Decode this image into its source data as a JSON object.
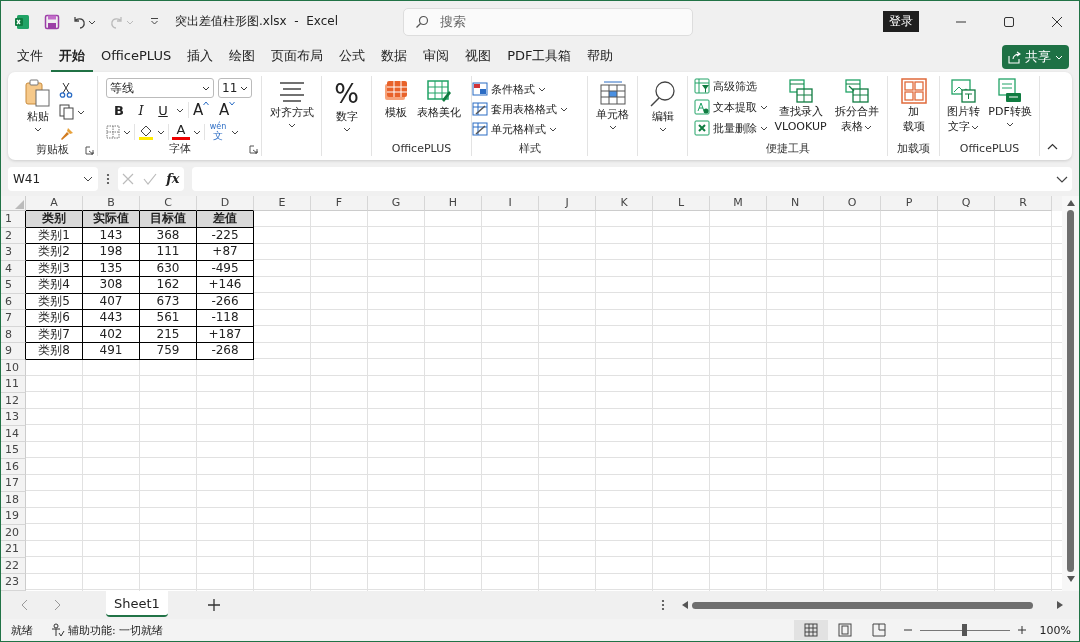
{
  "window": {
    "title": "突出差值柱形图.xlsx  -  Excel",
    "search_placeholder": "搜索",
    "sign_in": "登录"
  },
  "quick_access": {
    "redo_disabled": true
  },
  "menu_tabs": [
    {
      "label": "文件",
      "selected": false
    },
    {
      "label": "开始",
      "selected": true
    },
    {
      "label": "OfficePLUS",
      "selected": false
    },
    {
      "label": "插入",
      "selected": false
    },
    {
      "label": "绘图",
      "selected": false
    },
    {
      "label": "页面布局",
      "selected": false
    },
    {
      "label": "公式",
      "selected": false
    },
    {
      "label": "数据",
      "selected": false
    },
    {
      "label": "审阅",
      "selected": false
    },
    {
      "label": "视图",
      "selected": false
    },
    {
      "label": "PDF工具箱",
      "selected": false
    },
    {
      "label": "帮助",
      "selected": false
    }
  ],
  "share_button": "共享",
  "ribbon": {
    "clipboard": {
      "label": "剪贴板",
      "paste": "粘贴"
    },
    "font": {
      "label": "字体",
      "font_name": "等线",
      "font_size": "11",
      "bold": "B",
      "italic": "I",
      "underline": "U",
      "grow": "A",
      "shrink": "A",
      "font_color": "A",
      "phonetic": "wén",
      "phonetic_char": "文"
    },
    "alignment": {
      "label": "对齐方式"
    },
    "number": {
      "label": "数字",
      "symbol": "%"
    },
    "officeplus": {
      "label": "OfficePLUS",
      "buttons": [
        "模板",
        "表格美化"
      ]
    },
    "styles": {
      "label": "样式",
      "buttons": [
        "条件格式",
        "套用表格格式",
        "单元格样式"
      ]
    },
    "cells": {
      "label": "单元格"
    },
    "editing": {
      "label": "编辑"
    },
    "quick_tools": {
      "label": "便捷工具",
      "small_buttons": [
        {
          "label": "高级筛选",
          "dropdown": false
        },
        {
          "label": "文本提取",
          "dropdown": true
        },
        {
          "label": "批量删除",
          "dropdown": true
        }
      ],
      "large_buttons": [
        {
          "lines": [
            "查找录入",
            "VLOOKUP"
          ],
          "dropdown": false
        },
        {
          "lines": [
            "拆分合并",
            "表格"
          ],
          "dropdown": true
        }
      ]
    },
    "addins": {
      "label": "加载项",
      "lines": [
        "加",
        "载项"
      ]
    },
    "officeplus2": {
      "label": "OfficePLUS",
      "buttons": [
        {
          "lines": [
            "图片转",
            "文字"
          ],
          "dropdown": true
        },
        {
          "lines": [
            "PDF转换"
          ],
          "dropdown": true
        }
      ]
    }
  },
  "formula_bar": {
    "name_box": "W41",
    "function_label": "fx"
  },
  "sheet": {
    "columns": [
      "A",
      "B",
      "C",
      "D",
      "E",
      "F",
      "G",
      "H",
      "I",
      "J",
      "K",
      "L",
      "M",
      "N",
      "O",
      "P",
      "Q",
      "R"
    ],
    "row_numbers": [
      "1",
      "2",
      "3",
      "4",
      "5",
      "6",
      "7",
      "8",
      "9",
      "10",
      "11",
      "12",
      "13",
      "14",
      "15",
      "16",
      "17",
      "18",
      "19",
      "20",
      "21",
      "22",
      "23"
    ],
    "cells": [
      [
        "类别",
        "实际值",
        "目标值",
        "差值"
      ],
      [
        "类别1",
        "143",
        "368",
        "-225"
      ],
      [
        "类别2",
        "198",
        "111",
        "+87"
      ],
      [
        "类别3",
        "135",
        "630",
        "-495"
      ],
      [
        "类别4",
        "308",
        "162",
        "+146"
      ],
      [
        "类别5",
        "407",
        "673",
        "-266"
      ],
      [
        "类别6",
        "443",
        "561",
        "-118"
      ],
      [
        "类别7",
        "402",
        "215",
        "+187"
      ],
      [
        "类别8",
        "491",
        "759",
        "-268"
      ]
    ]
  },
  "sheet_tabs": [
    {
      "label": "Sheet1",
      "selected": true
    }
  ],
  "status_bar": {
    "ready": "就绪",
    "accessibility": "辅助功能: 一切就绪",
    "views": [
      {
        "selected": true
      },
      {
        "selected": false
      },
      {
        "selected": false
      }
    ],
    "zoom": {
      "level": 0.5
    },
    "zoom_label": "100%"
  }
}
